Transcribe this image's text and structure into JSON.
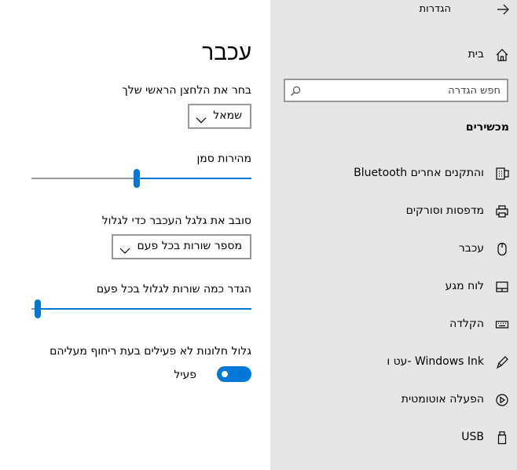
{
  "nav": {
    "back_label": "הגדרות",
    "home_label": "בית",
    "search_placeholder": "חפש הגדרה",
    "section_title": "מכשירים",
    "items": [
      {
        "label": "Bluetooth והתקנים אחרים",
        "icon": "bluetooth-devices-icon"
      },
      {
        "label": "מדפסות וסורקים",
        "icon": "printer-icon"
      },
      {
        "label": "עכבר",
        "icon": "mouse-icon"
      },
      {
        "label": "לוח מגע",
        "icon": "touchpad-icon"
      },
      {
        "label": "הקלדה",
        "icon": "keyboard-icon"
      },
      {
        "label": "עט ו- Windows Ink",
        "icon": "pen-icon"
      },
      {
        "label": "הפעלה אוטומטית",
        "icon": "autoplay-icon"
      },
      {
        "label": "USB",
        "icon": "usb-icon"
      }
    ]
  },
  "main": {
    "title": "עכבר",
    "primary_button": {
      "label": "בחר את הלחצן הראשי שלך",
      "value": "שמאל"
    },
    "cursor_speed": {
      "label": "מהירות סמן",
      "value_fraction": 0.52
    },
    "wheel_scroll": {
      "label": "סובב את גלגל העכבר כדי לגלול",
      "value": "מספר שורות בכל פעם"
    },
    "lines_to_scroll": {
      "label": "הגדר כמה שורות לגלול בכל פעם",
      "value_fraction": 0.97
    },
    "inactive_scroll": {
      "label": "גלול חלונות לא פעילים בעת ריחוף מעליהם",
      "state": "פעיל",
      "on": true
    }
  },
  "colors": {
    "accent": "#0078d7",
    "nav_bg": "#e6e6e6",
    "track": "#999999"
  }
}
